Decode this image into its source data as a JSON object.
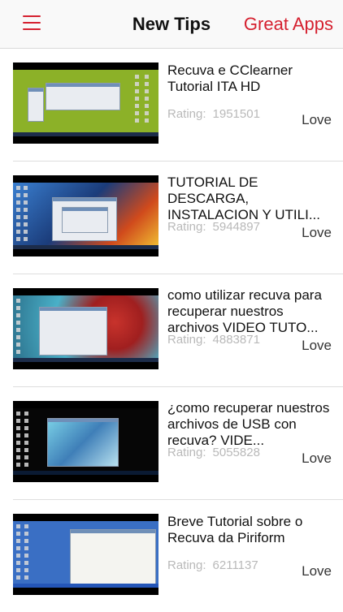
{
  "nav": {
    "title": "New Tips",
    "right_label": "Great Apps",
    "menu_icon": "hamburger-menu-icon",
    "accent_color": "#d5202f"
  },
  "items": [
    {
      "title": "Recuva e CClearner Tutorial ITA HD",
      "rating_label": "Rating:",
      "rating": "1951501",
      "action": "Love"
    },
    {
      "title": "TUTORIAL DE DESCARGA, INSTALACION Y UTILI...",
      "rating_label": "Rating:",
      "rating": "5944897",
      "action": "Love"
    },
    {
      "title": "como utilizar recuva para recuperar nuestros archivos VIDEO TUTO...",
      "rating_label": "Rating:",
      "rating": "4883871",
      "action": "Love"
    },
    {
      "title": "¿como recuperar nuestros archivos de USB con recuva? VIDE...",
      "rating_label": "Rating:",
      "rating": "5055828",
      "action": "Love"
    },
    {
      "title": "Breve Tutorial sobre o Recuva da Piriform",
      "rating_label": "Rating:",
      "rating": "6211137",
      "action": "Love"
    }
  ]
}
